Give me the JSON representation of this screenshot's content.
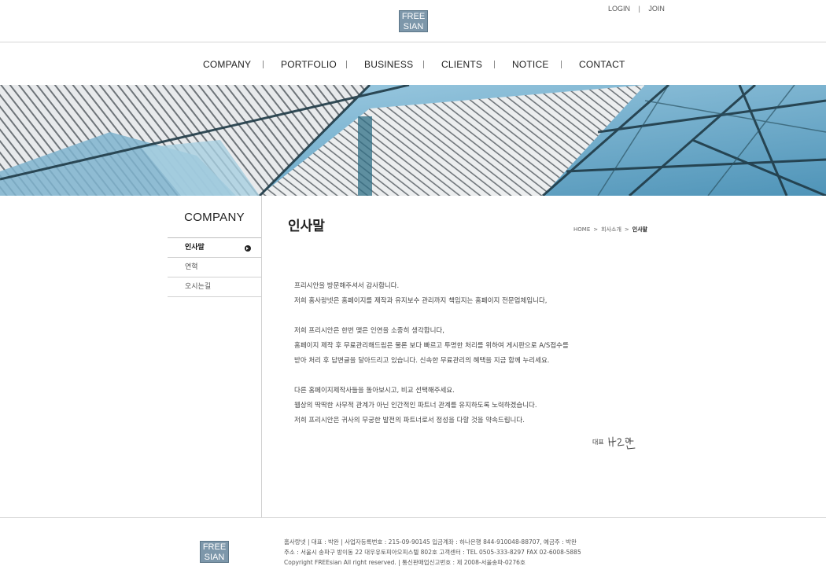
{
  "brand": {
    "logo_line1": "FREE",
    "logo_line2": "SIAN"
  },
  "util": {
    "login": "LOGIN",
    "join": "JOIN",
    "sep": "|"
  },
  "gnb": [
    {
      "label": "COMPANY"
    },
    {
      "label": "PORTFOLIO"
    },
    {
      "label": "BUSINESS"
    },
    {
      "label": "CLIENTS"
    },
    {
      "label": "NOTICE"
    },
    {
      "label": "CONTACT"
    }
  ],
  "sidebar": {
    "title": "COMPANY",
    "items": [
      {
        "label": "인사말",
        "active": true,
        "icon": "circle-arrow-right-icon"
      },
      {
        "label": "연혁"
      },
      {
        "label": "오시는길"
      }
    ]
  },
  "content": {
    "title": "인사말",
    "breadcrumb": {
      "home": "HOME",
      "sep": ">",
      "section": "회사소개",
      "current": "인사말"
    },
    "paragraphs": [
      [
        "프리시안을 방문해주셔서 감사합니다.",
        "저희 홈사랑넷은 홈페이지를 제작과 유지보수 관리까지 책임지는 홈페이지 전문업체입니다,"
      ],
      [
        "저희 프리시안은 한번 맺은 인연을 소중히 생각합니다,",
        "홈페이지 제작 후 무료관리해드림은 물론 보다 빠르고 투명한 처리를 위하여 게시판으로 A/S접수를",
        "받아 처리 후 답변글을 달아드리고 있습니다. 신속한 무료관리의 혜택을 지금 함께 누리세요."
      ],
      [
        "다른 홈페이지제작사들을 돌아보시고, 비교 선택해주세요.",
        "웹상의 딱딱한 사무적 관계가 아닌 인간적인 파트너 관계를 유지하도록 노력하겠습니다.",
        "저희 프리시안은 귀사의 무궁한 발전의 파트너로서 정성을 다할 것을 약속드립니다."
      ]
    ],
    "signature": {
      "label": "대표",
      "name": "박완"
    }
  },
  "footer": {
    "lines": [
      "홈사랑넷  |  대표 : 박완  |  사업자등록번호 : 215-09-90145  입금계좌 : 하나은행 844-910048-88707, 예금주 : 박완",
      "주소 : 서울시 송파구 방이동 22 대우유토피아오피스텔 802호   고객센터 : TEL 0505-333-8297    FAX 02-6008-5885",
      "Copyright FREEsian All right reserved.   |  통신판매업신고번호 : 제 2008-서울송파-0276호"
    ]
  },
  "colors": {
    "logo_bg": "#7d97aa",
    "line": "#d6d6d6",
    "text": "#444444"
  }
}
